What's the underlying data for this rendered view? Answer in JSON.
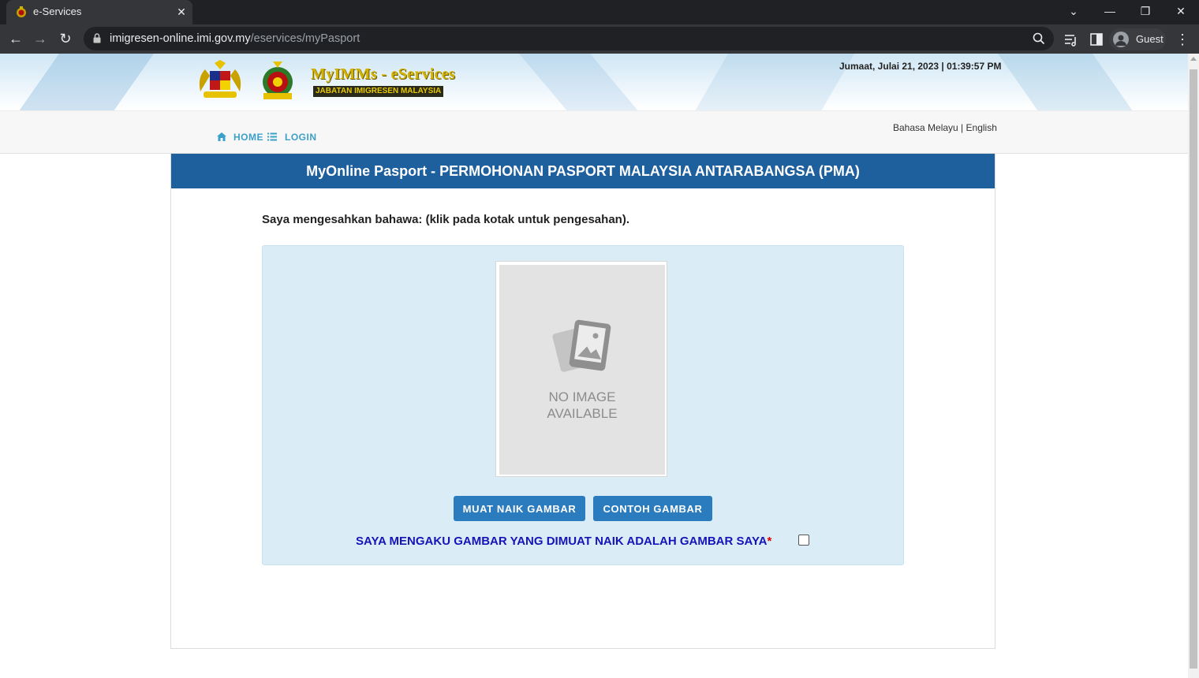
{
  "browser": {
    "tab_title": "e-Services",
    "url_host": "imigresen-online.imi.gov.my",
    "url_path": "/eservices/myPasport",
    "profile_label": "Guest"
  },
  "header": {
    "brand_title": "MyIMMs - eServices",
    "brand_subtitle": "JABATAN IMIGRESEN MALAYSIA",
    "datetime": "Jumaat, Julai 21, 2023 | 01:39:57 PM"
  },
  "nav": {
    "home": "HOME",
    "login": "LOGIN",
    "lang_ms": "Bahasa Melayu",
    "lang_sep": " | ",
    "lang_en": "English"
  },
  "panel": {
    "title": "MyOnline Pasport - PERMOHONAN PASPORT MALAYSIA ANTARABANGSA (PMA)",
    "confirm_text": "Saya mengesahkan bahawa: (klik pada kotak untuk pengesahan).",
    "no_image_line1": "NO IMAGE",
    "no_image_line2": "AVAILABLE",
    "upload_button": "MUAT NAIK GAMBAR",
    "sample_button": "CONTOH GAMBAR",
    "ack_text": "SAYA MENGAKU GAMBAR YANG DIMUAT NAIK ADALAH GAMBAR SAYA",
    "ack_required": "*",
    "ack_checked": false
  },
  "colors": {
    "panel_header": "#1e5f9e",
    "button": "#2b7bbf",
    "photo_box_bg": "#daedf6",
    "nav_link": "#3aa0c8",
    "ack_text": "#1414b8"
  }
}
